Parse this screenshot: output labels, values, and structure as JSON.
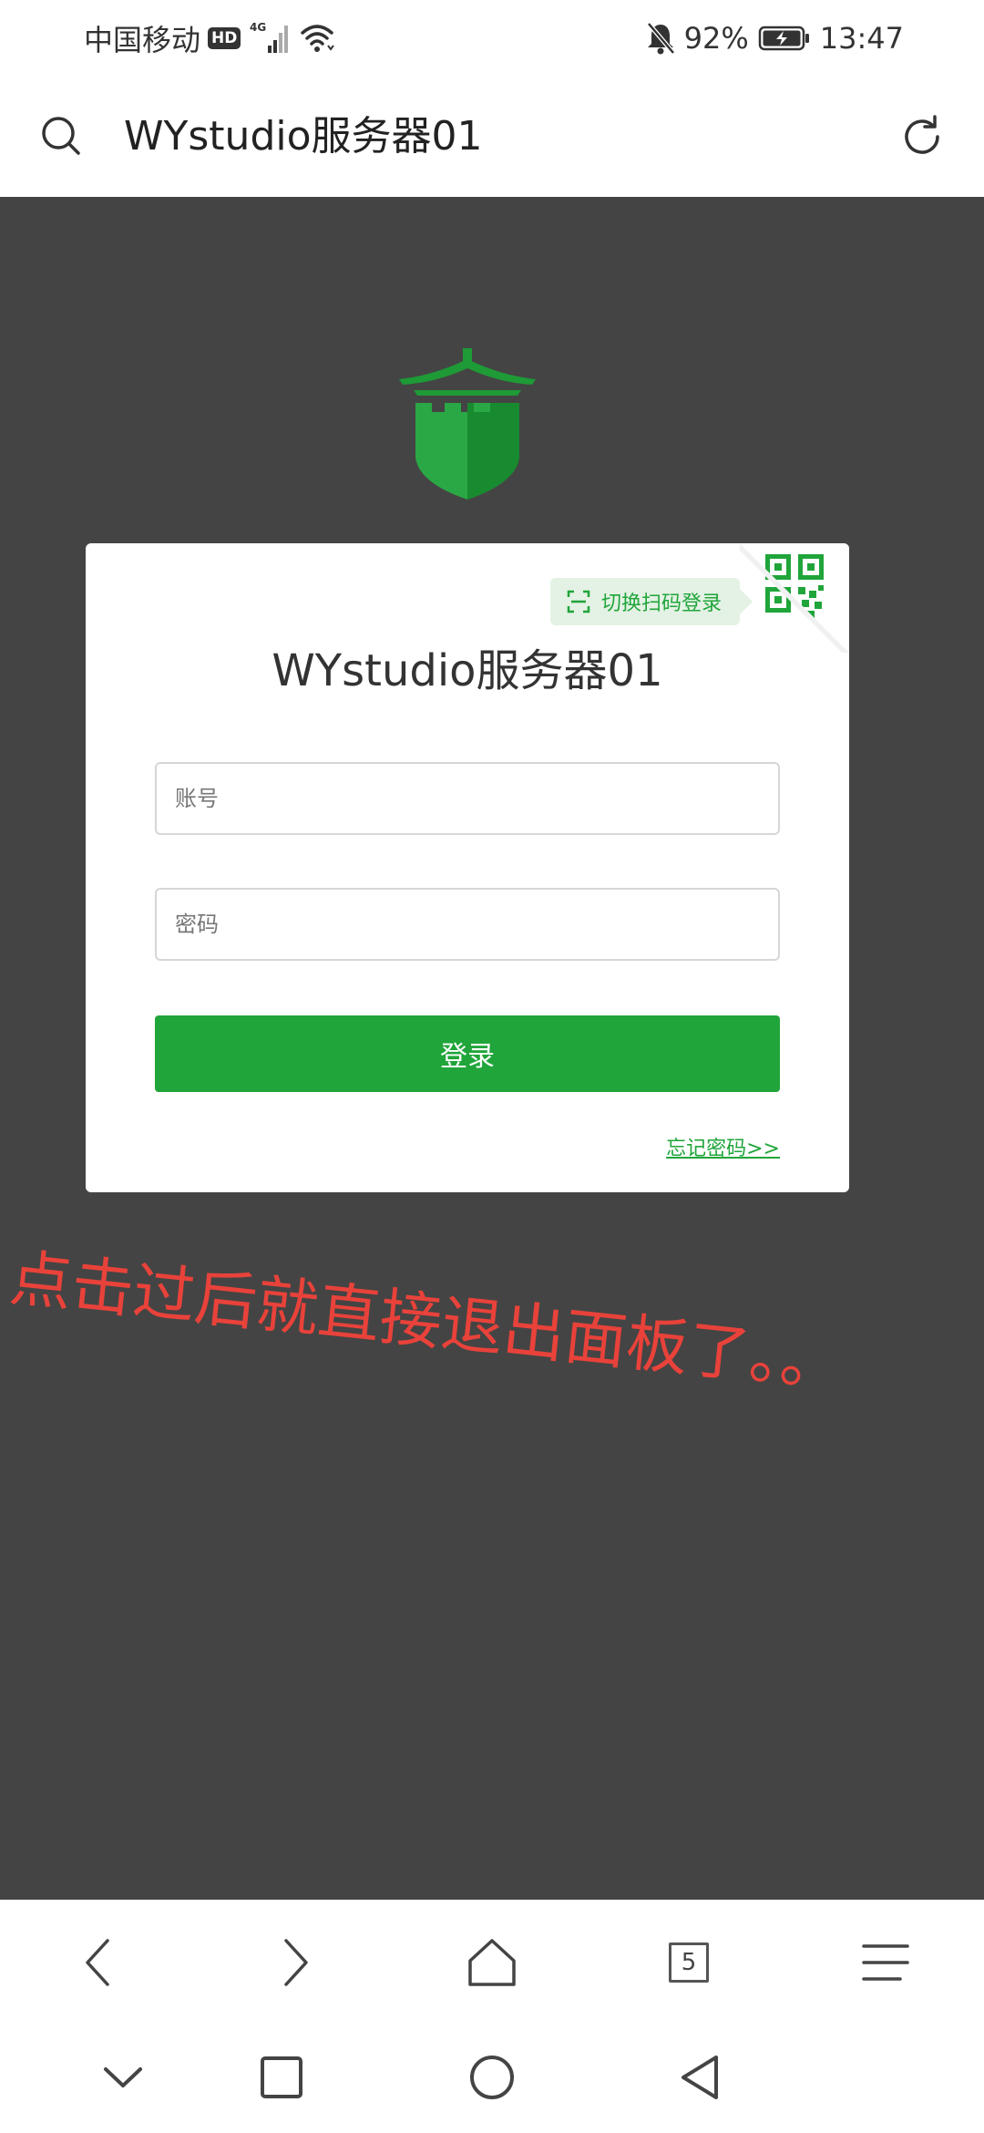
{
  "status_bar": {
    "carrier": "中国移动",
    "hd_label": "HD",
    "network_label": "4G",
    "battery_percent": "92%",
    "time": "13:47"
  },
  "browser_header": {
    "page_title": "WYstudio服务器01"
  },
  "login_card": {
    "qr_switch_label": "切换扫码登录",
    "title": "WYstudio服务器01",
    "username_placeholder": "账号",
    "password_placeholder": "密码",
    "login_button": "登录",
    "forgot_password_link": "忘记密码>>"
  },
  "annotation": {
    "text": "点击过后就直接退出面板了。。"
  },
  "browser_toolbar": {
    "tab_count": "5"
  },
  "colors": {
    "brand_green": "#20a53a",
    "content_background": "#444444",
    "annotation_red": "#e8423a"
  },
  "icons": {
    "header": [
      "search-icon",
      "reload-icon"
    ],
    "toolbar": [
      "back-arrow-icon",
      "forward-arrow-icon",
      "home-icon",
      "tabs-icon",
      "menu-icon"
    ],
    "system_nav": [
      "collapse-chevron-icon",
      "recents-square-icon",
      "home-circle-icon",
      "back-triangle-icon"
    ]
  }
}
